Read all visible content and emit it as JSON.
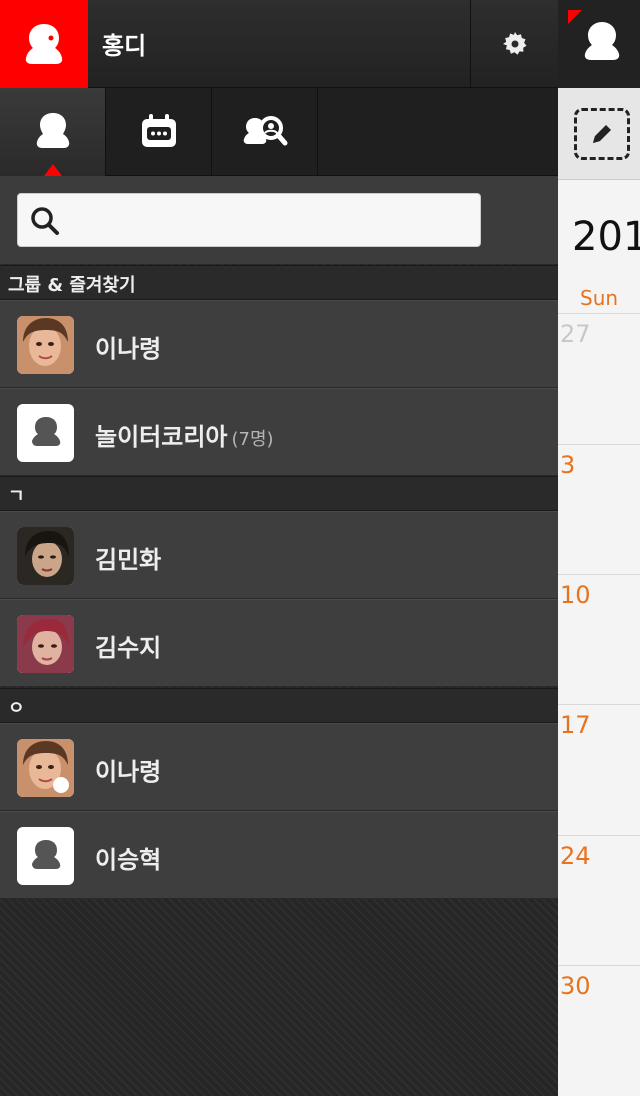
{
  "me": {
    "name": "홍디"
  },
  "tabs": [
    {
      "id": "friend",
      "icon": "person-icon"
    },
    {
      "id": "chat-cal",
      "icon": "chat-calendar-icon"
    },
    {
      "id": "search-people",
      "icon": "search-people-icon"
    }
  ],
  "search": {
    "placeholder": ""
  },
  "categories": {
    "favorites": "그룹 & 즐겨찾기",
    "giyeok": "ㄱ",
    "ieung": "ㅇ"
  },
  "friends": [
    {
      "name": "이나령",
      "avatar": "photo-1",
      "count": ""
    },
    {
      "name": "놀이터코리아",
      "avatar": "default",
      "count": "(7명)"
    },
    {
      "name": "김민화",
      "avatar": "photo-2",
      "count": ""
    },
    {
      "name": "김수지",
      "avatar": "photo-3",
      "count": ""
    },
    {
      "name": "이나령",
      "avatar": "photo-1",
      "count": ""
    },
    {
      "name": "이승혁",
      "avatar": "default",
      "count": ""
    }
  ],
  "calendar": {
    "year": "201",
    "day_of_week": "Sun",
    "dates": [
      "27",
      "3",
      "10",
      "17",
      "24",
      "30"
    ]
  },
  "colors": {
    "accent": "#ff0000",
    "calendar_text": "#e8731e",
    "name_text": "#eeeeee",
    "count_text": "#b5b5b5",
    "header_name": "#fefefe"
  }
}
